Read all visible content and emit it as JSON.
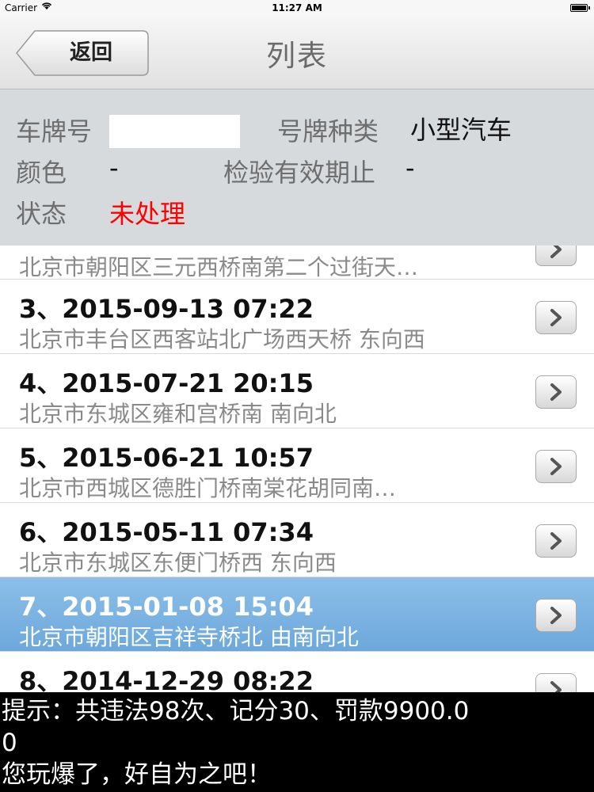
{
  "status": {
    "carrier": "Carrier",
    "time": "11:27 AM"
  },
  "nav": {
    "back_label": "返回",
    "title": "列表"
  },
  "info": {
    "plate_label": "车牌号",
    "plate_value": "",
    "plate_type_label": "号牌种类",
    "plate_type_value": "小型汽车",
    "color_label": "颜色",
    "color_value": "-",
    "inspect_label": "检验有效期止",
    "inspect_value": "-",
    "state_label": "状态",
    "state_value": "未处理",
    "state_color": "#ff0000"
  },
  "list": {
    "items": [
      {
        "title": "",
        "location": "北京市朝阳区三元西桥南第二个过街天…"
      },
      {
        "title": "3、2015-09-13 07:22",
        "location": "北京市丰台区西客站北广场西天桥 东向西"
      },
      {
        "title": "4、2015-07-21 20:15",
        "location": "北京市东城区雍和宫桥南 南向北"
      },
      {
        "title": "5、2015-06-21 10:57",
        "location": "北京市西城区德胜门桥南棠花胡同南…"
      },
      {
        "title": "6、2015-05-11 07:34",
        "location": "北京市东城区东便门桥西 东向西"
      },
      {
        "title": "7、2015-01-08 15:04",
        "location": "北京市朝阳区吉祥寺桥北 由南向北",
        "selected": true
      },
      {
        "title": "8、2014-12-29 08:22",
        "location": ""
      }
    ]
  },
  "footer": {
    "line1": "提示：共违法98次、记分30、罚款9900.0",
    "line2": "0",
    "line3": "您玩爆了，好自为之吧！"
  }
}
